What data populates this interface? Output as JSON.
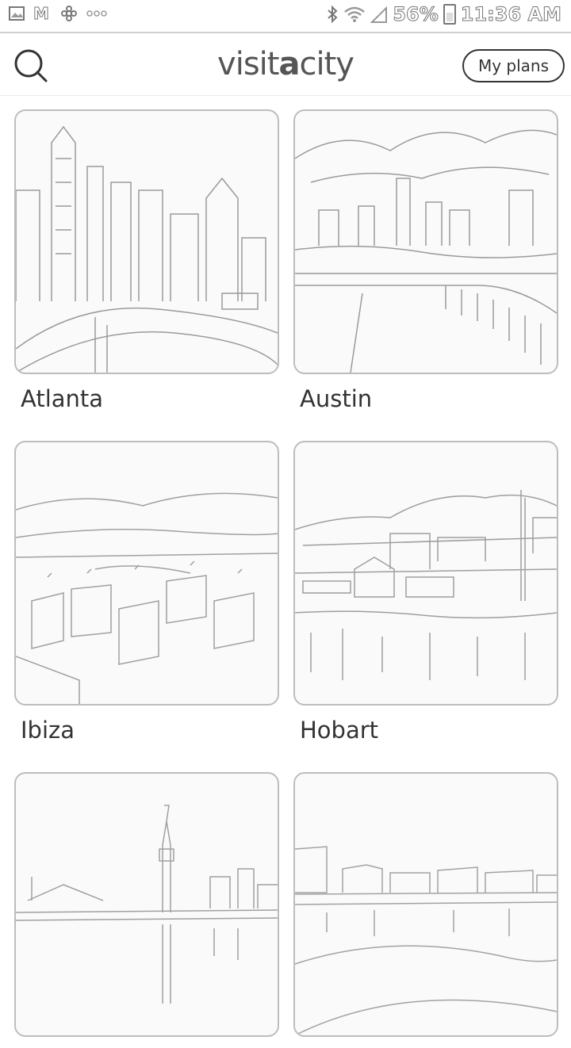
{
  "status_bar": {
    "icons_left": [
      "image-icon",
      "gmail-icon",
      "flower-icon",
      "more-icon"
    ],
    "icons_right": [
      "bluetooth-icon",
      "wifi-icon",
      "signal-icon",
      "battery-icon"
    ],
    "battery": "56%",
    "time": "11:36 AM"
  },
  "header": {
    "brand_left": "visit",
    "brand_mid": "a",
    "brand_right": "city",
    "my_plans_label": "My plans",
    "search_icon": "search-icon"
  },
  "cities": [
    {
      "name": "Atlanta"
    },
    {
      "name": "Austin"
    },
    {
      "name": "Ibiza"
    },
    {
      "name": "Hobart"
    },
    {
      "name": ""
    },
    {
      "name": ""
    }
  ],
  "colors": {
    "background": "#ffffff",
    "text": "#333333",
    "border": "#bdbdbd"
  }
}
